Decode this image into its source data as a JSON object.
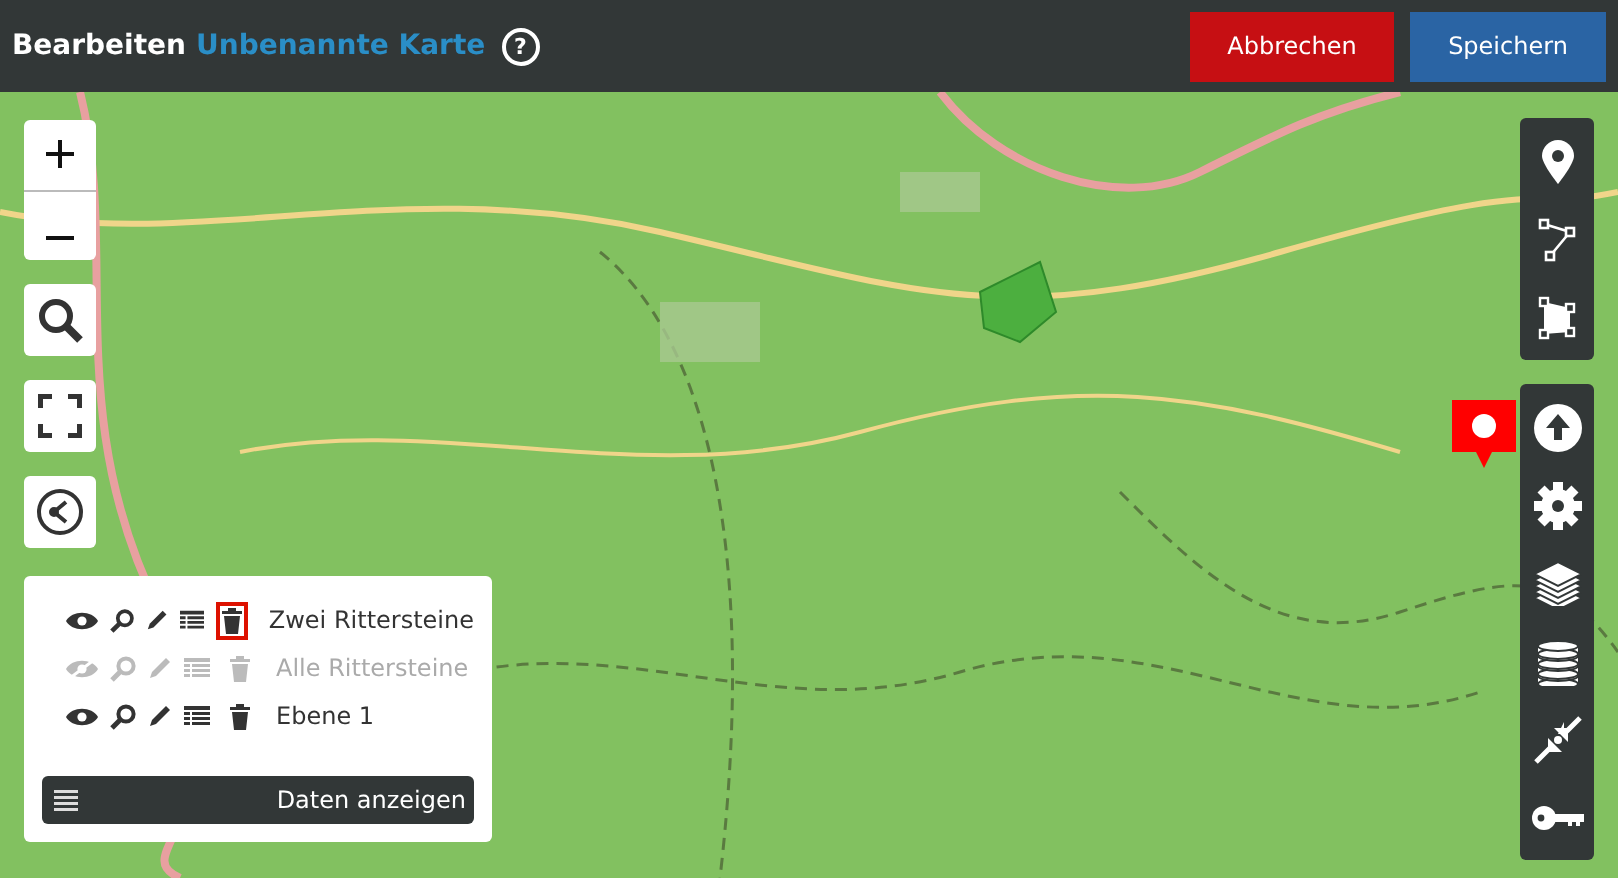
{
  "header": {
    "mode": "Bearbeiten",
    "map_title": "Unbenannte Karte",
    "help": "?"
  },
  "buttons": [
    {
      "label": "Abbrechen",
      "kind": "cancel"
    },
    {
      "label": "Speichern",
      "kind": "save"
    }
  ],
  "layers": [
    {
      "name": "Zwei Rittersteine",
      "visible": true,
      "highlighted": true
    },
    {
      "name": "Alle Rittersteine",
      "visible": false,
      "highlighted": false
    },
    {
      "name": "Ebene 1",
      "visible": true,
      "highlighted": false
    }
  ],
  "data_button": {
    "label": "Daten anzeigen"
  }
}
